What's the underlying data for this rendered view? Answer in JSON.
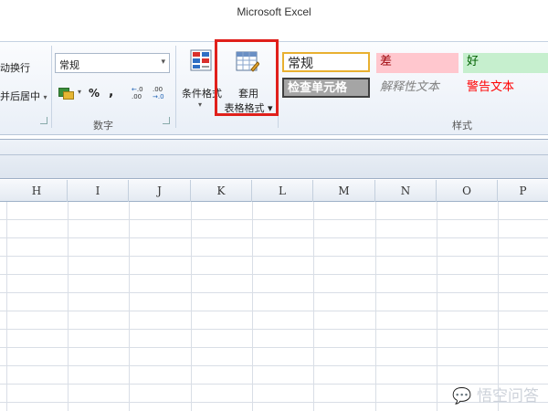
{
  "window": {
    "title": "Microsoft Excel"
  },
  "ribbon": {
    "alignment": {
      "wrap_text": "动换行",
      "merge_center": "并后居中",
      "merge_dropdown": "▾"
    },
    "number": {
      "format_value": "常规",
      "format_arrow": "▾",
      "percent": "%",
      "comma": ",",
      "increase_decimal": [
        ".0",
        ".00"
      ],
      "decrease_decimal": [
        ".00",
        "→.0"
      ],
      "group_label": "数字"
    },
    "conditional_format": {
      "label": "条件格式",
      "dropdown": "▾"
    },
    "format_as_table": {
      "label_line1": "套用",
      "label_line2": "表格格式 ▾"
    },
    "styles": {
      "normal": "常规",
      "bad": "差",
      "good": "好",
      "check_cell": "检查单元格",
      "explanatory": "解释性文本",
      "warning": "警告文本",
      "group_label": "样式"
    }
  },
  "grid": {
    "columns": [
      "H",
      "I",
      "J",
      "K",
      "L",
      "M",
      "N",
      "O",
      "P"
    ]
  },
  "watermark": "悟空问答",
  "colors": {
    "highlight": "#e0201b",
    "bad_bg": "#ffc7ce",
    "good_bg": "#c6efce",
    "warning_text": "#ff0000"
  }
}
